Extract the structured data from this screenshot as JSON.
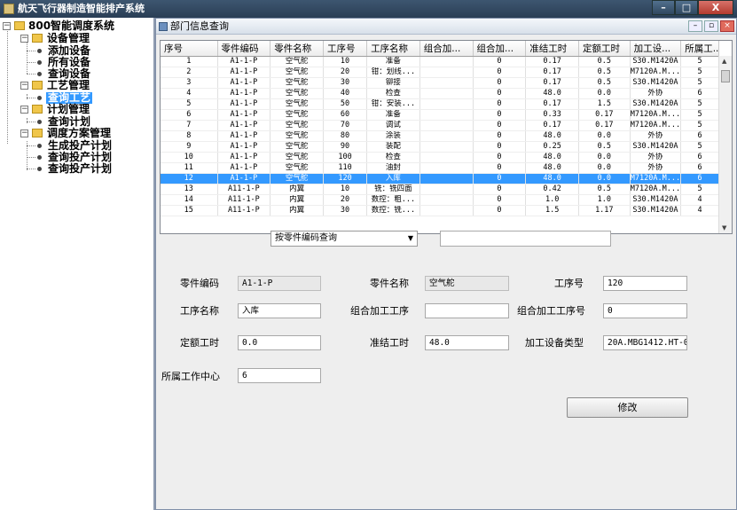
{
  "window": {
    "title": "航天飞行器制造智能排产系统",
    "controls": [
      "–",
      "□",
      "X"
    ]
  },
  "tree": {
    "root": "800智能调度系统",
    "groups": [
      {
        "label": "设备管理",
        "items": [
          "添加设备",
          "所有设备",
          "查询设备"
        ]
      },
      {
        "label": "工艺管理",
        "items": [
          "查询工艺"
        ]
      },
      {
        "label": "计划管理",
        "items": [
          "查询计划"
        ]
      },
      {
        "label": "调度方案管理",
        "items": [
          "生成投产计划",
          "查询投产计划",
          "查询投产计划"
        ]
      }
    ],
    "selected": "查询工艺"
  },
  "inner_window": {
    "title": "部门信息查询"
  },
  "table": {
    "columns": [
      "序号",
      "零件编码",
      "零件名称",
      "工序号",
      "工序名称",
      "组合加...",
      "组合加...",
      "准结工时",
      "定额工时",
      "加工设...",
      "所属工..."
    ],
    "rows": [
      [
        "1",
        "A1-1-P",
        "空气舵",
        "10",
        "准备",
        "",
        "0",
        "0.17",
        "0.5",
        "S30.M1420A",
        "5"
      ],
      [
        "2",
        "A1-1-P",
        "空气舵",
        "20",
        "钳：划线...",
        "",
        "0",
        "0.17",
        "0.5",
        "M7120A.M...",
        "5"
      ],
      [
        "3",
        "A1-1-P",
        "空气舵",
        "30",
        "铆接",
        "",
        "0",
        "0.17",
        "0.5",
        "S30.M1420A",
        "5"
      ],
      [
        "4",
        "A1-1-P",
        "空气舵",
        "40",
        "检查",
        "",
        "0",
        "48.0",
        "0.0",
        "外协",
        "6"
      ],
      [
        "5",
        "A1-1-P",
        "空气舵",
        "50",
        "钳：安装...",
        "",
        "0",
        "0.17",
        "1.5",
        "S30.M1420A",
        "5"
      ],
      [
        "6",
        "A1-1-P",
        "空气舵",
        "60",
        "准备",
        "",
        "0",
        "0.33",
        "0.17",
        "M7120A.M...",
        "5"
      ],
      [
        "7",
        "A1-1-P",
        "空气舵",
        "70",
        "调试",
        "",
        "0",
        "0.17",
        "0.17",
        "M7120A.M...",
        "5"
      ],
      [
        "8",
        "A1-1-P",
        "空气舵",
        "80",
        "涂装",
        "",
        "0",
        "48.0",
        "0.0",
        "外协",
        "6"
      ],
      [
        "9",
        "A1-1-P",
        "空气舵",
        "90",
        "装配",
        "",
        "0",
        "0.25",
        "0.5",
        "S30.M1420A",
        "5"
      ],
      [
        "10",
        "A1-1-P",
        "空气舵",
        "100",
        "检查",
        "",
        "0",
        "48.0",
        "0.0",
        "外协",
        "6"
      ],
      [
        "11",
        "A1-1-P",
        "空气舵",
        "110",
        "油封",
        "",
        "0",
        "48.0",
        "0.0",
        "外协",
        "6"
      ],
      [
        "12",
        "A1-1-P",
        "空气舵",
        "120",
        "入库",
        "",
        "0",
        "48.0",
        "0.0",
        "M7120A.M...",
        "6"
      ],
      [
        "13",
        "A11-1-P",
        "内翼",
        "10",
        "铣：铣四面",
        "",
        "0",
        "0.42",
        "0.5",
        "M7120A.M...",
        "5"
      ],
      [
        "14",
        "A11-1-P",
        "内翼",
        "20",
        "数控：粗...",
        "",
        "0",
        "1.0",
        "1.0",
        "S30.M1420A",
        "4"
      ],
      [
        "15",
        "A11-1-P",
        "内翼",
        "30",
        "数控：铣...",
        "",
        "0",
        "1.5",
        "1.17",
        "S30.M1420A",
        "4"
      ]
    ],
    "selected_row": 11
  },
  "search": {
    "mode": "按零件编码查询",
    "query": ""
  },
  "form": {
    "part_code_label": "零件编码",
    "part_code": "A1-1-P",
    "part_name_label": "零件名称",
    "part_name": "空气舵",
    "op_no_label": "工序号",
    "op_no": "120",
    "op_name_label": "工序名称",
    "op_name": "入库",
    "combo_op_label": "组合加工工序",
    "combo_op": "",
    "combo_op_no_label": "组合加工工序号",
    "combo_op_no": "0",
    "quota_hours_label": "定额工时",
    "quota_hours": "0.0",
    "setup_hours_label": "准结工时",
    "setup_hours": "48.0",
    "equip_type_label": "加工设备类型",
    "equip_type": "20A.MBG1412.HT-025",
    "work_center_label": "所属工作中心",
    "work_center": "6",
    "modify_label": "修改"
  }
}
